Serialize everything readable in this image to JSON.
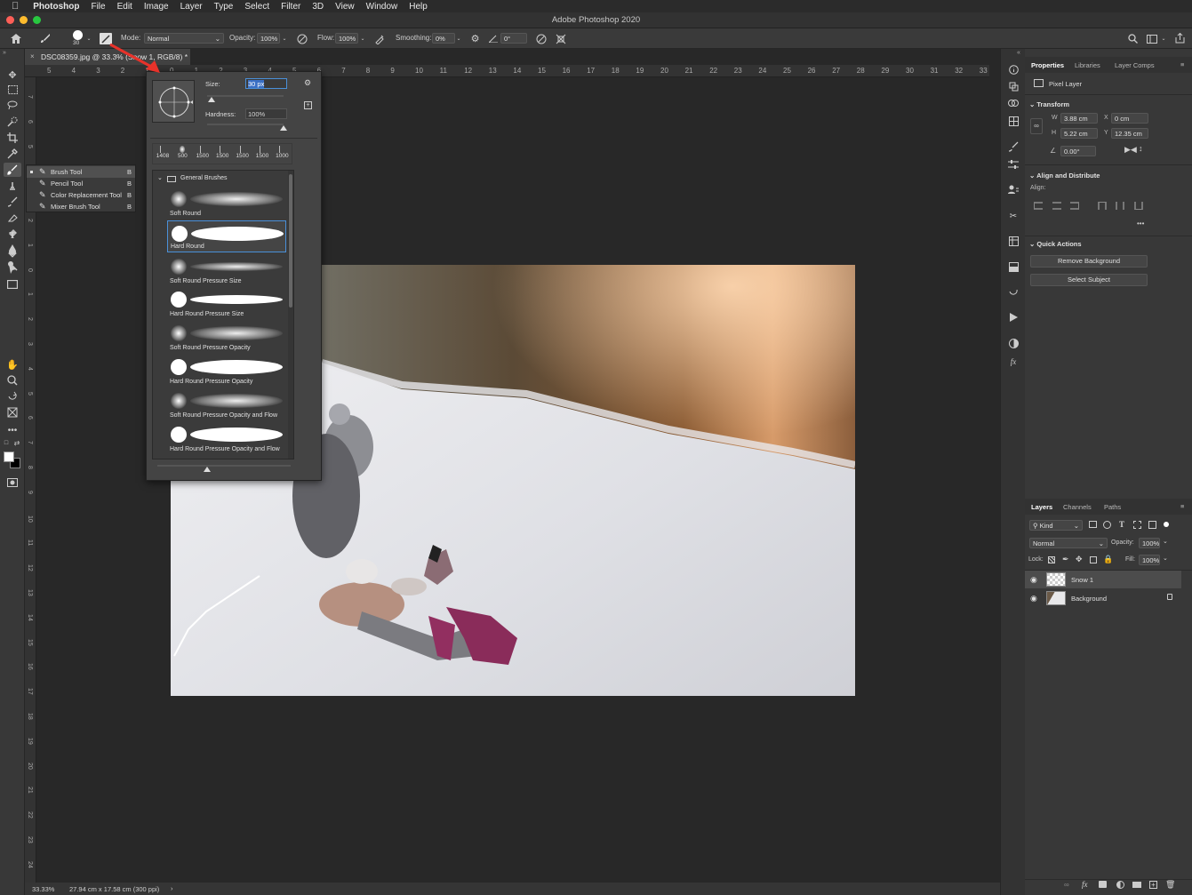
{
  "menubar": {
    "apple_icon": "apple-icon",
    "items": [
      "Photoshop",
      "File",
      "Edit",
      "Image",
      "Layer",
      "Type",
      "Select",
      "Filter",
      "3D",
      "View",
      "Window",
      "Help"
    ]
  },
  "window": {
    "title": "Adobe Photoshop 2020"
  },
  "options": {
    "brush_size": "30",
    "mode_label": "Mode:",
    "mode_value": "Normal",
    "opacity_label": "Opacity:",
    "opacity_value": "100%",
    "flow_label": "Flow:",
    "flow_value": "100%",
    "smoothing_label": "Smoothing:",
    "smoothing_value": "0%",
    "angle_value": "0°"
  },
  "document": {
    "tab_title": "DSC08359.jpg @ 33.3% (Snow 1, RGB/8) *"
  },
  "ruler": {
    "top": [
      "5",
      "4",
      "3",
      "2",
      "1",
      "0",
      "1",
      "2",
      "3",
      "4",
      "5",
      "6",
      "7",
      "8",
      "9",
      "10",
      "11",
      "12",
      "13",
      "14",
      "15",
      "16",
      "17",
      "18",
      "19",
      "20",
      "21",
      "22",
      "23",
      "24",
      "25",
      "26",
      "27",
      "28",
      "29",
      "30",
      "31",
      "32",
      "33"
    ],
    "left": [
      "7",
      "6",
      "5",
      "4",
      "3",
      "2",
      "1",
      "0",
      "1",
      "2",
      "3",
      "4",
      "5",
      "6",
      "7",
      "8",
      "9",
      "10",
      "11",
      "12",
      "13",
      "14",
      "15",
      "16",
      "17",
      "18",
      "19",
      "20",
      "21",
      "22",
      "23",
      "24"
    ]
  },
  "status": {
    "zoom": "33.33%",
    "doc_info": "27.94 cm x 17.58 cm (300 ppi)"
  },
  "tool_flyout": {
    "items": [
      {
        "label": "Brush Tool",
        "key": "B",
        "icon": "brush-icon"
      },
      {
        "label": "Pencil Tool",
        "key": "B",
        "icon": "pencil-icon"
      },
      {
        "label": "Color Replacement Tool",
        "key": "B",
        "icon": "color-replacement-icon"
      },
      {
        "label": "Mixer Brush Tool",
        "key": "B",
        "icon": "mixer-brush-icon"
      }
    ]
  },
  "brush_picker": {
    "size_label": "Size:",
    "size_value": "30 px",
    "hardness_label": "Hardness:",
    "hardness_value": "100%",
    "size_fraction": 0.06,
    "hardness_fraction": 1.0,
    "recent_sizes": [
      "1408",
      "500",
      "1500",
      "1500",
      "1500",
      "1500",
      "1000"
    ],
    "folder": "General Brushes",
    "brushes": [
      {
        "name": "Soft Round",
        "selected": false
      },
      {
        "name": "Hard Round",
        "selected": true
      },
      {
        "name": "Soft Round Pressure Size",
        "selected": false
      },
      {
        "name": "Hard Round Pressure Size",
        "selected": false
      },
      {
        "name": "Soft Round Pressure Opacity",
        "selected": false
      },
      {
        "name": "Hard Round Pressure Opacity",
        "selected": false
      },
      {
        "name": "Soft Round Pressure Opacity and Flow",
        "selected": false
      },
      {
        "name": "Hard Round Pressure Opacity and Flow",
        "selected": false
      }
    ]
  },
  "properties": {
    "tabs": [
      "Properties",
      "Libraries",
      "Layer Comps"
    ],
    "layer_type": "Pixel Layer",
    "transform": {
      "title": "Transform",
      "w_label": "W",
      "w": "3.88 cm",
      "x_label": "X",
      "x": "0 cm",
      "h_label": "H",
      "h": "5.22 cm",
      "y_label": "Y",
      "y": "12.35 cm",
      "angle": "0.00°"
    },
    "align": {
      "title": "Align and Distribute",
      "label": "Align:"
    },
    "quick_actions": {
      "title": "Quick Actions",
      "remove_bg": "Remove Background",
      "select_subject": "Select Subject"
    }
  },
  "layers": {
    "tabs": [
      "Layers",
      "Channels",
      "Paths"
    ],
    "filter": "Kind",
    "blend": "Normal",
    "opacity_label": "Opacity:",
    "opacity": "100%",
    "lock_label": "Lock:",
    "fill_label": "Fill:",
    "fill": "100%",
    "items": [
      {
        "name": "Snow 1",
        "selected": true,
        "visible": true,
        "locked": false
      },
      {
        "name": "Background",
        "selected": false,
        "visible": true,
        "locked": true
      }
    ]
  },
  "colors": {
    "accent": "#4a90d9",
    "arrow": "#e8322a"
  }
}
